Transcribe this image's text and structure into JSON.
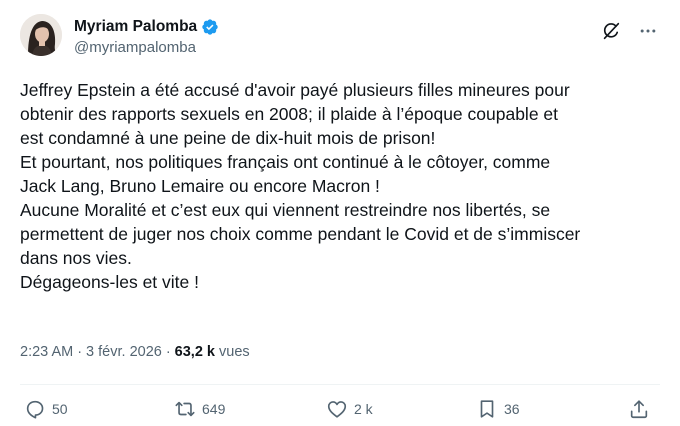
{
  "author": {
    "display_name": "Myriam Palomba",
    "handle": "@myriampalomba",
    "verified_icon": "verified-badge-icon",
    "avatar": "profile-avatar"
  },
  "header_actions": {
    "grok_icon": "grok-icon",
    "more_icon": "more-options-icon"
  },
  "body": {
    "lines": [
      "Jeffrey Epstein a été accusé d'avoir payé plusieurs filles mineures pour",
      "obtenir des rapports sexuels en 2008; il plaide à l’époque coupable et",
      "est condamné à une peine de dix-huit mois de prison!",
      "Et pourtant, nos politiques français ont continué à le côtoyer, comme",
      "Jack Lang, Bruno Lemaire ou encore Macron !",
      "Aucune Moralité et c’est eux qui viennent restreindre nos libertés, se",
      "permettent de juger nos choix comme pendant le Covid et de s’immiscer",
      "dans nos vies.",
      "Dégageons-les et vite !"
    ]
  },
  "meta": {
    "time": "2:23 AM",
    "separator": "·",
    "date": "3 févr. 2026",
    "views_count": "63,2 k",
    "views_label": "vues"
  },
  "actions": {
    "replies": "50",
    "reposts": "649",
    "likes": "2 k",
    "bookmarks": "36"
  },
  "colors": {
    "text_primary": "#0f1419",
    "text_secondary": "#536471",
    "verified_blue": "#1d9bf0",
    "divider": "#eff3f4"
  }
}
